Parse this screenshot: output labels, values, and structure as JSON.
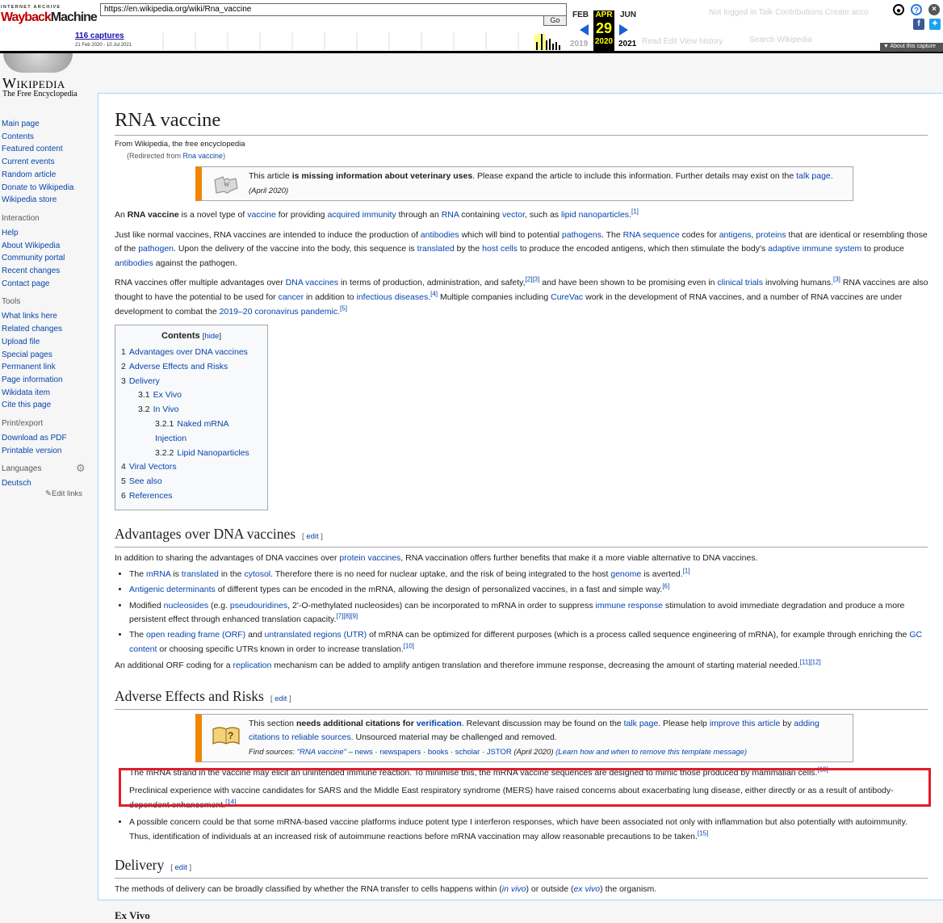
{
  "wayback": {
    "logo_top": "INTERNET ARCHIVE",
    "logo_main_a": "Wayback",
    "logo_main_b": "Machine",
    "url": "https://en.wikipedia.org/wiki/Rna_vaccine",
    "go": "Go",
    "captures": "116 captures",
    "range": "21 Feb 2020 - 10 Jul 2021",
    "prev_month": "FEB",
    "cur_month": "APR",
    "next_month": "JUN",
    "cur_day": "29",
    "prev_year": "2019",
    "cur_year": "2020",
    "next_year": "2021",
    "about": "About this capture",
    "ghost_nav": "Not logged in  Talk  Contributions  Create acco",
    "ghost_tabs": "Read   Edit   View history",
    "ghost_search": "Search Wikipedia"
  },
  "logo": {
    "word": "Wikipedia",
    "tagline": "The Free Encyclopedia"
  },
  "sidebar": {
    "nav": [
      "Main page",
      "Contents",
      "Featured content",
      "Current events",
      "Random article",
      "Donate to Wikipedia",
      "Wikipedia store"
    ],
    "interaction_heading": "Interaction",
    "interaction": [
      "Help",
      "About Wikipedia",
      "Community portal",
      "Recent changes",
      "Contact page"
    ],
    "tools_heading": "Tools",
    "tools": [
      "What links here",
      "Related changes",
      "Upload file",
      "Special pages",
      "Permanent link",
      "Page information",
      "Wikidata item",
      "Cite this page"
    ],
    "print_heading": "Print/export",
    "print": [
      "Download as PDF",
      "Printable version"
    ],
    "languages_heading": "Languages",
    "languages": [
      "Deutsch"
    ],
    "edit_links": "Edit links"
  },
  "article": {
    "title": "RNA vaccine",
    "site_sub": "From Wikipedia, the free encyclopedia",
    "redirect_prefix": "(Redirected from ",
    "redirect_link": "Rna vaccine",
    "redirect_suffix": ")",
    "ambox1": {
      "t1": "This article ",
      "bold": "is missing information about veterinary uses",
      "t2": ". Please expand the article to include this information. Further details may exist on the ",
      "link": "talk page",
      "t3": ".",
      "date": "(April 2020)"
    },
    "toc": {
      "title": "Contents",
      "hide": "hide",
      "items": [
        {
          "num": "1",
          "label": "Advantages over DNA vaccines",
          "level": 1
        },
        {
          "num": "2",
          "label": "Adverse Effects and Risks",
          "level": 1
        },
        {
          "num": "3",
          "label": "Delivery",
          "level": 1
        },
        {
          "num": "3.1",
          "label": "Ex Vivo",
          "level": 2
        },
        {
          "num": "3.2",
          "label": "In Vivo",
          "level": 2
        },
        {
          "num": "3.2.1",
          "label": "Naked mRNA Injection",
          "level": 3
        },
        {
          "num": "3.2.2",
          "label": "Lipid Nanoparticles",
          "level": 3
        },
        {
          "num": "4",
          "label": "Viral Vectors",
          "level": 1
        },
        {
          "num": "5",
          "label": "See also",
          "level": 1
        },
        {
          "num": "6",
          "label": "References",
          "level": 1
        }
      ]
    },
    "h_advantages": "Advantages over DNA vaccines",
    "h_adverse": "Adverse Effects and Risks",
    "h_delivery": "Delivery",
    "edit": "edit",
    "ambox2": {
      "t1": "This section ",
      "bold": "needs additional citations for ",
      "bold_link": "verification",
      "t2": ". Relevant discussion may be found on the ",
      "link1": "talk page",
      "t3": ". Please help ",
      "link2": "improve this article",
      "t4": " by ",
      "link3": "adding citations to reliable sources",
      "t5": ". Unsourced material may be challenged and removed.",
      "find_label": "Find sources: ",
      "find_q": "\"RNA vaccine\"",
      "find_dash": " – ",
      "find_links": [
        "news",
        "newspapers",
        "books",
        "scholar",
        "JSTOR"
      ],
      "find_date": " (April 2020) ",
      "learn": "(Learn how and when to remove this template message)"
    },
    "delivery_text_1": "The methods of delivery can be broadly classified by whether the RNA transfer to cells happens within (",
    "delivery_link_1": "in vivo",
    "delivery_text_2": ") or outside (",
    "delivery_link_2": "ex vivo",
    "delivery_text_3": ") the organism.",
    "ex_vivo_cut": "Ex Vivo"
  },
  "colors": {
    "link": "#0645ad",
    "ambox_content": "#f28500",
    "highlight": "#e21d2a"
  }
}
